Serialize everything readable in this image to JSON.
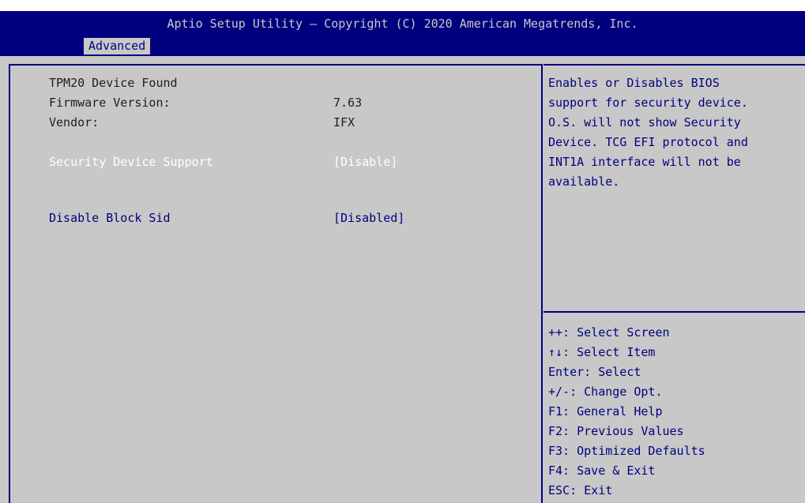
{
  "header": {
    "title": "Aptio Setup Utility – Copyright (C) 2020 American Megatrends, Inc.",
    "tab": "Advanced"
  },
  "info": {
    "device_found": "TPM20 Device Found",
    "firmware_label": "Firmware Version:",
    "firmware_value": "7.63",
    "vendor_label": "Vendor:",
    "vendor_value": "IFX"
  },
  "options": {
    "security_label": "Security Device Support",
    "security_value": "[Disable]",
    "blocksid_label": "Disable Block Sid",
    "blocksid_value": "[Disabled]"
  },
  "help": {
    "lines": [
      "Enables or Disables BIOS",
      "support for security device.",
      "O.S. will not show Security",
      "Device. TCG EFI protocol and",
      "INT1A interface will not be",
      "available."
    ]
  },
  "keys": {
    "lines": [
      "++: Select Screen",
      "↑↓: Select Item",
      "Enter: Select",
      "+/-: Change Opt.",
      "F1: General Help",
      "F2: Previous Values",
      "F3: Optimized Defaults",
      "F4: Save & Exit",
      "ESC: Exit"
    ]
  },
  "colors": {
    "header_bg": "#00007f",
    "panel_bg": "#c8c8c8",
    "selected_text": "#ffffff",
    "option_text": "#00007f",
    "static_text": "#1e1e1e"
  }
}
